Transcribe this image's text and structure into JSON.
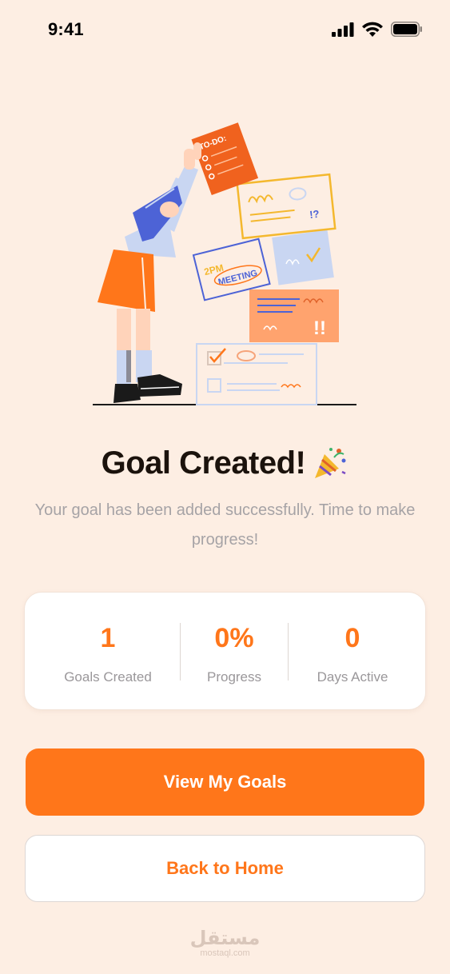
{
  "status_bar": {
    "time": "9:41",
    "icons": [
      "cellular-signal-icon",
      "wifi-icon",
      "battery-icon"
    ]
  },
  "illustration": {
    "name": "woman-stacking-task-cards-illustration",
    "card_texts": {
      "todo": "TO-DO:",
      "meeting_time": "2PM",
      "meeting": "MEETING",
      "exclaim_question": "!?",
      "exclaim": "!!"
    }
  },
  "header": {
    "title": "Goal Created!",
    "emoji_icon": "party-popper-icon",
    "subtitle": "Your goal has been added successfully. Time to make progress!"
  },
  "stats": [
    {
      "value": "1",
      "label": "Goals Created"
    },
    {
      "value": "0%",
      "label": "Progress"
    },
    {
      "value": "0",
      "label": "Days Active"
    }
  ],
  "actions": {
    "primary_label": "View My Goals",
    "secondary_label": "Back to Home"
  },
  "watermark": {
    "main": "مستقل",
    "sub": "mostaql.com"
  },
  "colors": {
    "background": "#FDEEE3",
    "accent": "#FF761A",
    "title": "#1B120C",
    "muted_text": "#A6A3A6",
    "card": "#FFFFFF"
  }
}
